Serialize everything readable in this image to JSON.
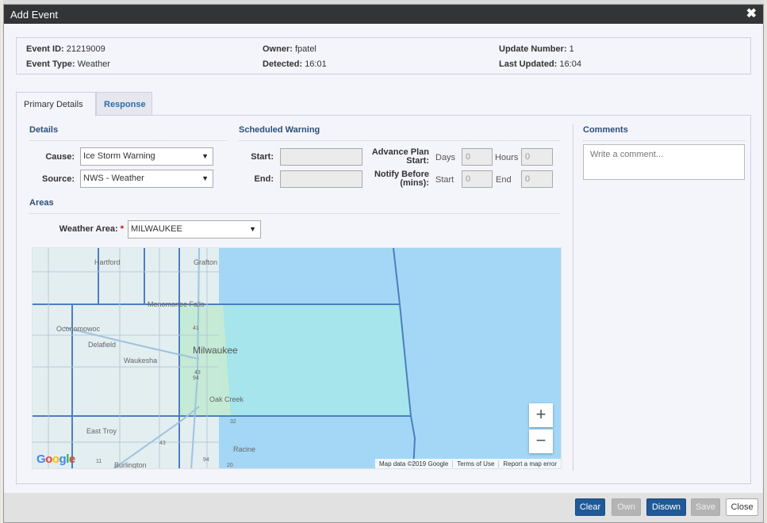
{
  "dialog": {
    "title": "Add Event"
  },
  "info": {
    "event_id_label": "Event ID:",
    "event_id": "21219009",
    "event_type_label": "Event Type:",
    "event_type": "Weather",
    "owner_label": "Owner:",
    "owner": "fpatel",
    "detected_label": "Detected:",
    "detected": "16:01",
    "update_number_label": "Update Number:",
    "update_number": "1",
    "last_updated_label": "Last Updated:",
    "last_updated": "16:04"
  },
  "tabs": [
    {
      "label": "Primary Details",
      "active": true
    },
    {
      "label": "Response",
      "active": false
    }
  ],
  "details": {
    "heading": "Details",
    "cause_label": "Cause:",
    "cause_value": "Ice Storm Warning",
    "source_label": "Source:",
    "source_value": "NWS - Weather"
  },
  "scheduled": {
    "heading": "Scheduled Warning",
    "start_label": "Start:",
    "end_label": "End:",
    "advance_label_1": "Advance Plan",
    "advance_label_2": "Start:",
    "notify_label_1": "Notify Before",
    "notify_label_2": "(mins):",
    "days_label": "Days",
    "hours_label": "Hours",
    "start_sub_label": "Start",
    "end_sub_label": "End",
    "days_value": "0",
    "hours_value": "0",
    "notify_start_value": "0",
    "notify_end_value": "0"
  },
  "areas": {
    "heading": "Areas",
    "weather_area_label": "Weather Area:",
    "required_mark": "*",
    "weather_area_value": "MILWAUKEE"
  },
  "comments": {
    "heading": "Comments",
    "placeholder": "Write a comment..."
  },
  "map": {
    "places": [
      "Hartford",
      "Grafton",
      "Menomonee Falls",
      "Oconomowoc",
      "Delafield",
      "Waukesha",
      "Milwaukee",
      "Oak Creek",
      "East Troy",
      "Racine",
      "Burlington"
    ],
    "route_shields": [
      "43",
      "94",
      "41",
      "32",
      "43",
      "11",
      "94",
      "20"
    ],
    "google_text": "Google",
    "attribution": "Map data ©2019 Google",
    "terms": "Terms of Use",
    "report": "Report a map error",
    "zoom_in": "+",
    "zoom_out": "−",
    "water_color": "#a3d7f5",
    "region_color": "#a5e6ea",
    "land_color": "#e3eef0",
    "boundary_color": "#4c7fbf"
  },
  "buttons": {
    "clear": "Clear",
    "own": "Own",
    "disown": "Disown",
    "save": "Save",
    "close": "Close"
  }
}
